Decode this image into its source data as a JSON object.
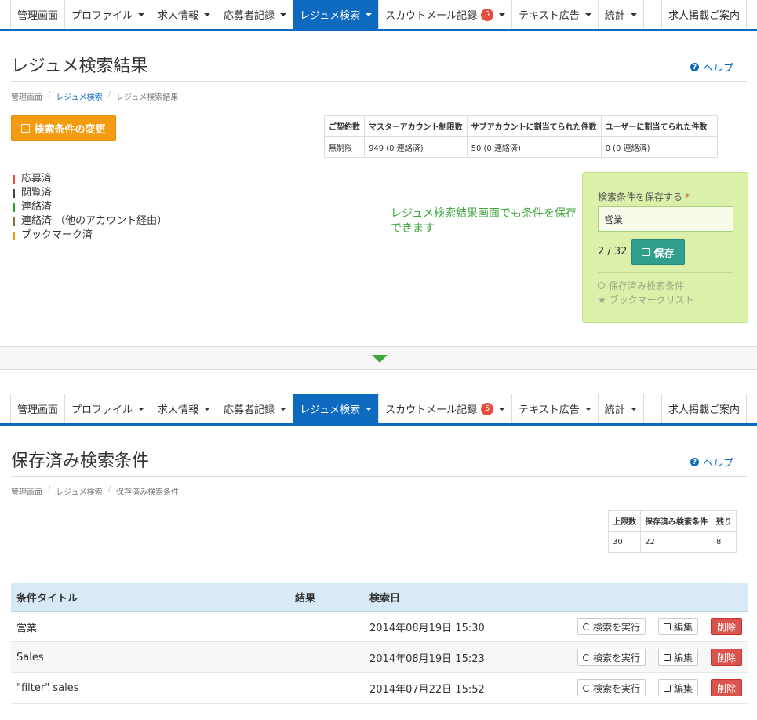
{
  "nav": {
    "items": [
      {
        "label": "管理画面",
        "caret": false
      },
      {
        "label": "プロファイル",
        "caret": true
      },
      {
        "label": "求人情報",
        "caret": true
      },
      {
        "label": "応募者記録",
        "caret": true
      },
      {
        "label": "レジュメ検索",
        "caret": true,
        "active": true
      },
      {
        "label": "スカウトメール記録",
        "caret": true,
        "badge": "5"
      },
      {
        "label": "テキスト広告",
        "caret": true
      },
      {
        "label": "統計",
        "caret": true
      },
      {
        "label": "",
        "caret": false
      }
    ],
    "right_label": "求人掲載ご案内"
  },
  "top": {
    "title": "レジュメ検索結果",
    "help": "ヘルプ",
    "breadcrumb": [
      "管理画面",
      "レジュメ検索",
      "レジュメ検索結果"
    ],
    "change_button": "検索条件の変更",
    "stats": {
      "headers": [
        "ご契約数",
        "マスターアカウント制限数",
        "サブアカウントに割当てられた件数",
        "ユーザーに割当てられた件数"
      ],
      "row": [
        "無制限",
        "949 (0 連絡済)",
        "50 (0 連絡済)",
        "0 (0 連絡済)"
      ]
    },
    "legend": [
      {
        "label": "応募済",
        "color": "#e74c3c"
      },
      {
        "label": "閲覧済",
        "color": "#444444"
      },
      {
        "label": "連絡済",
        "color": "#2ea02e"
      },
      {
        "label": "連絡済 （他のアカウント経由）",
        "color": "#8a6d3b"
      },
      {
        "label": "ブックマーク済",
        "color": "#f39c12"
      }
    ],
    "annotation": "レジュメ検索結果画面でも条件を保存できます",
    "save_panel": {
      "label": "検索条件を保存する",
      "required_mark": "*",
      "input_value": "営業",
      "count": "2 / 32",
      "save_button": "保存",
      "link_saved": "保存済み検索条件",
      "link_bookmarks": "ブックマークリスト"
    }
  },
  "bottom": {
    "title": "保存済み検索条件",
    "help": "ヘルプ",
    "breadcrumb": [
      "管理画面",
      "レジュメ検索",
      "保存済み検索条件"
    ],
    "limits": {
      "headers": [
        "上限数",
        "保存済み検索条件",
        "残り"
      ],
      "row": [
        "30",
        "22",
        "8"
      ]
    },
    "conditions": {
      "headers": [
        "条件タイトル",
        "結果",
        "検索日"
      ],
      "run_label": "検索を実行",
      "edit_label": "編集",
      "delete_label": "削除",
      "rows": [
        {
          "title": "営業",
          "result": "",
          "date": "2014年08月19日 15:30"
        },
        {
          "title": "Sales",
          "result": "",
          "date": "2014年08月19日 15:23"
        },
        {
          "title": "\"filter\" sales",
          "result": "",
          "date": "2014年07月22日 15:52"
        }
      ]
    }
  },
  "colors": {
    "brand_blue": "#0d6abf",
    "orange": "#f39c12",
    "teal": "#2f9e8d",
    "annotation_green": "#3ea63e",
    "danger": "#d9534f"
  }
}
